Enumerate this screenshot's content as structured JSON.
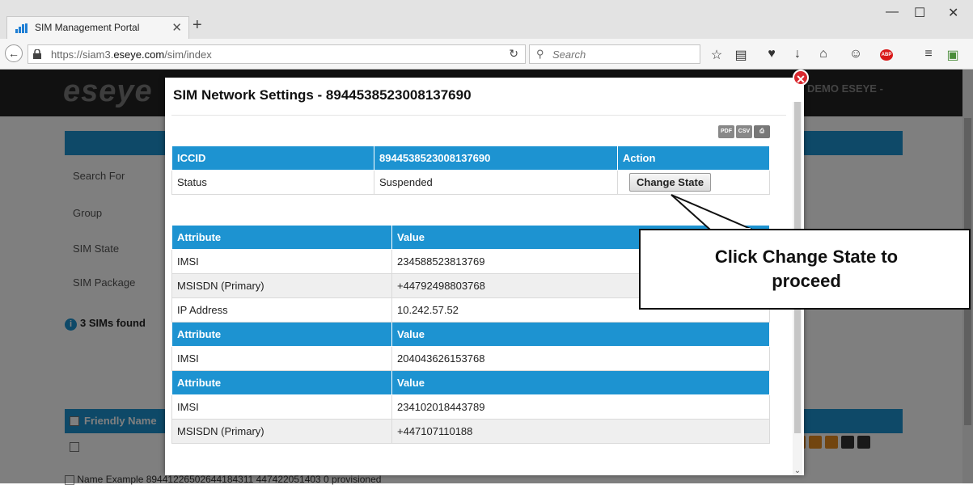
{
  "browser": {
    "tab_title": "SIM Management Portal",
    "url_prefix": "https://siam3.",
    "url_domain": "eseye.com",
    "url_path": "/sim/index",
    "search_placeholder": "Search",
    "abp_label": "ABP"
  },
  "page": {
    "logo": "eseye",
    "account": "DEMO ESEYE -",
    "filters": [
      "Search For",
      "Group",
      "SIM State",
      "SIM Package"
    ],
    "found": "3 SIMs found",
    "list_header": "Friendly Name",
    "row_preview": "Name Example   89441226502644184311   447422051403   0   provisioned"
  },
  "modal": {
    "title": "SIM Network Settings - 8944538523008137690",
    "exports": [
      "PDF",
      "CSV"
    ],
    "summary": {
      "headers": [
        "ICCID",
        "8944538523008137690",
        "Action"
      ],
      "status_label": "Status",
      "status_value": "Suspended",
      "action_button": "Change State"
    },
    "attr_header": "Attribute",
    "value_header": "Value",
    "group1": [
      {
        "attr": "IMSI",
        "value": "234588523813769"
      },
      {
        "attr": "MSISDN (Primary)",
        "value": "+44792498803768"
      },
      {
        "attr": "IP Address",
        "value": "10.242.57.52"
      }
    ],
    "group2": [
      {
        "attr": "IMSI",
        "value": "204043626153768"
      }
    ],
    "group3": [
      {
        "attr": "IMSI",
        "value": "234102018443789"
      },
      {
        "attr": "MSISDN (Primary)",
        "value": "+447107110188"
      }
    ]
  },
  "callout": {
    "line1": "Click Change State to",
    "line2": "proceed"
  }
}
